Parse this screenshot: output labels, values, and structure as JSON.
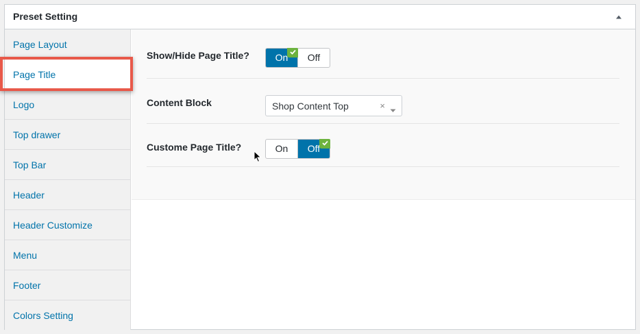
{
  "panel": {
    "title": "Preset Setting",
    "collapse_icon": "triangle-up-icon"
  },
  "sidebar": {
    "active_index": 1,
    "items": [
      {
        "label": "Page Layout"
      },
      {
        "label": "Page Title"
      },
      {
        "label": "Logo"
      },
      {
        "label": "Top drawer"
      },
      {
        "label": "Top Bar"
      },
      {
        "label": "Header"
      },
      {
        "label": "Header Customize"
      },
      {
        "label": "Menu"
      },
      {
        "label": "Footer"
      },
      {
        "label": "Colors Setting"
      }
    ]
  },
  "fields": {
    "show_hide_title": {
      "label": "Show/Hide Page Title?",
      "on_label": "On",
      "off_label": "Off",
      "selected": "on"
    },
    "content_block": {
      "label": "Content Block",
      "value": "Shop Content Top",
      "clear_symbol": "×"
    },
    "custom_title": {
      "label": "Custome Page Title?",
      "on_label": "On",
      "off_label": "Off",
      "selected": "off"
    }
  },
  "colors": {
    "accent": "#0073aa",
    "check_badge": "#6db33f",
    "highlight": "#e8594a"
  }
}
